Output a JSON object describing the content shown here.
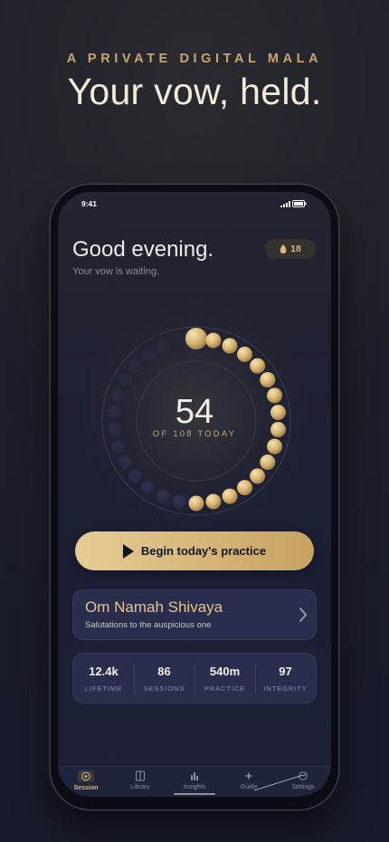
{
  "marketing": {
    "eyebrow": "A PRIVATE DIGITAL MALA",
    "headline": "Your vow, held."
  },
  "status_bar": {
    "time": "9:41"
  },
  "greeting": {
    "title": "Good evening.",
    "subtitle": "Your vow is waiting."
  },
  "streak": {
    "count": "18",
    "icon": "flame-icon"
  },
  "counter": {
    "count": "54",
    "caption": "OF 108 TODAY",
    "progress_fraction": 0.5
  },
  "primary_action": {
    "label": "Begin today's practice",
    "icon": "play-icon"
  },
  "mantra": {
    "title": "Om Namah Shivaya",
    "subtitle": "Salutations to the auspicious one"
  },
  "stats": [
    {
      "value": "12.4k",
      "label": "LIFETIME"
    },
    {
      "value": "86",
      "label": "SESSIONS"
    },
    {
      "value": "540m",
      "label": "PRACTICE"
    },
    {
      "value": "97",
      "label": "INTEGRITY"
    }
  ],
  "tabs": [
    {
      "label": "Session",
      "icon": "target-icon",
      "active": true
    },
    {
      "label": "Library",
      "icon": "book-icon",
      "active": false
    },
    {
      "label": "Insights",
      "icon": "bar-chart-icon",
      "active": false
    },
    {
      "label": "Guide",
      "icon": "sparkle-icon",
      "active": false
    },
    {
      "label": "Settings",
      "icon": "settings-icon",
      "active": false
    }
  ],
  "colors": {
    "accent_gold": "#d9b878",
    "background": "#1c1f34",
    "card": "#2a2e4c"
  }
}
